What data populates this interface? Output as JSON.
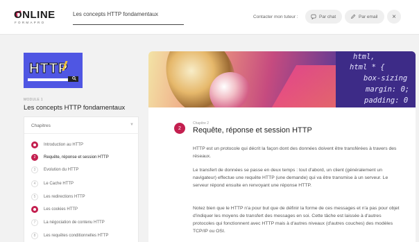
{
  "header": {
    "logo_text": "ONLINE",
    "logo_subtext": "FORMAPRO",
    "course_title": "Les concepts HTTP fondamentaux",
    "contact_label": "Contacter mon tuteur :",
    "chat_label": "Par chat",
    "email_label": "Par email",
    "close_label": "×"
  },
  "sidebar": {
    "thumbnail": {
      "text": "HTTP",
      "subtitle": "HYPERTEXT TRANSFER PROTOCOL",
      "search_glyph": "🔍"
    },
    "module_label": "MODULE 1",
    "module_title": "Les concepts HTTP fondamentaux",
    "chapters_label": "Chapitres",
    "chapters": [
      {
        "num": "1",
        "label": "Introduction au HTTP",
        "state": "done"
      },
      {
        "num": "2",
        "label": "Requête, réponse et session HTTP",
        "state": "current"
      },
      {
        "num": "3",
        "label": "Evolution du HTTP",
        "state": "todo"
      },
      {
        "num": "4",
        "label": "Le Cache HTTP",
        "state": "todo"
      },
      {
        "num": "5",
        "label": "Les redirections HTTP",
        "state": "todo"
      },
      {
        "num": "6",
        "label": "Les cookies HTTP",
        "state": "done"
      },
      {
        "num": "7",
        "label": "La négociation de contenu HTTP",
        "state": "todo"
      },
      {
        "num": "8",
        "label": "Les requêtes conditionnelles HTTP",
        "state": "todo"
      }
    ]
  },
  "banner_code": [
    "html,",
    "html * {",
    "box-sizing",
    "margin: 0;",
    "padding: 0"
  ],
  "content": {
    "chapter_number": "2",
    "chapter_label": "Chapitre 2",
    "title": "Requête, réponse et session HTTP",
    "paragraphs": [
      "HTTP est un protocole qui décrit la façon dont des données doivent être transférées à travers des réseaux.",
      "Le transfert de données se passe en deux temps : tout d'abord, un client (généralement un navigateur) effectue une requête HTTP (une demande) qui va être transmise à un serveur. Le serveur répond ensuite en renvoyant une réponse HTTP.",
      "Notez bien que le HTTP n'a pour but que de définir la forme de ces messages et n'a pas pour objet d'indiquer les moyens de transfert des messages en soi. Cette tâche est laissée à d'autres protocoles qui fonctionnent avec HTTP mais à d'autres niveaux (d'autres couches) des modèles TCP/IP ou OSI."
    ]
  },
  "colors": {
    "accent": "#c31f4f",
    "thumbnail_bg": "#4f56e3"
  }
}
